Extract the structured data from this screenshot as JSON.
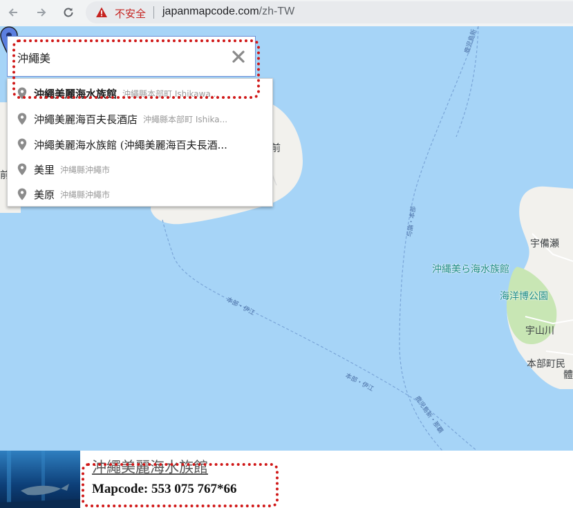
{
  "browser": {
    "security_label": "不安全",
    "url_host": "japanmapcode.com",
    "url_path": "/zh-TW"
  },
  "search": {
    "value": "沖繩美"
  },
  "suggestions": [
    {
      "main": "沖繩美麗海水族館",
      "sub": "沖繩縣本部町 Ishikawa..."
    },
    {
      "main": "沖繩美麗海百夫長酒店",
      "sub": "沖繩縣本部町 Ishika..."
    },
    {
      "main": "沖繩美麗海水族館 (沖繩美麗海百夫長酒...",
      "sub": ""
    },
    {
      "main": "美里",
      "sub": "沖縄縣沖繩市"
    },
    {
      "main": "美原",
      "sub": "沖縄縣沖繩市"
    }
  ],
  "map": {
    "place_labels": {
      "ubishi": "宇備瀬",
      "aquarium": "沖縄美ら海水族館",
      "park": "海洋博公園",
      "uzan": "宇山川",
      "motobu": "本部町民",
      "motobu_tail": "體",
      "islet_a": "前",
      "islet_b": "前"
    },
    "route_labels": {
      "r1": "本部・伊江",
      "r2": "本部・伊江",
      "r3": "与論・本部",
      "r4": "鹿児島新・那覇",
      "r5": "鹿児島新"
    }
  },
  "result": {
    "title": "沖繩美麗海水族館",
    "mapcode": "Mapcode: 553 075 767*66"
  },
  "colors": {
    "water": "#a6d4f7",
    "land": "#f2f1ed",
    "park": "#c8e6b4",
    "highlight": "#d01818",
    "pin": "#5b7fe0"
  }
}
